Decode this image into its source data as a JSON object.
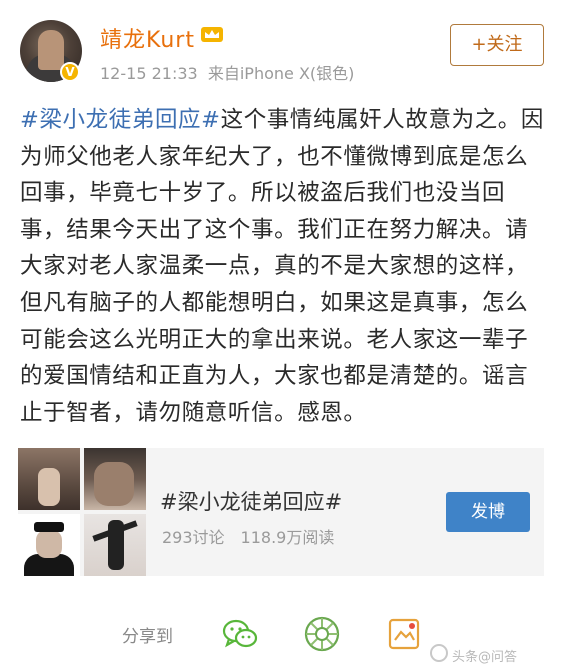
{
  "header": {
    "username": "靖龙Kurt",
    "verified_badge": "V",
    "timestamp": "12-15 21:33",
    "source": "来自iPhone X(银色)",
    "follow_label": "+关注",
    "crown_icon": "crown-icon"
  },
  "post": {
    "hashtag": "#梁小龙徒弟回应#",
    "text": "这个事情纯属奸人故意为之。因为师父他老人家年纪大了，也不懂微博到底是怎么回事，毕竟七十岁了。所以被盗后我们也没当回事，结果今天出了这个事。我们正在努力解决。请大家对老人家温柔一点，真的不是大家想的这样，但凡有脑子的人都能想明白，如果这是真事，怎么可能会这么光明正大的拿出来说。老人家这一辈子的爱国情结和正直为人，大家也都是清楚的。谣言止于智者，请勿随意听信。感恩。"
  },
  "topic_card": {
    "title": "#梁小龙徒弟回应#",
    "discussions": "293讨论",
    "reads": "118.9万阅读",
    "post_button": "发博"
  },
  "share": {
    "label": "分享到",
    "icons": [
      "wechat-icon",
      "moments-icon",
      "weibo-icon"
    ]
  },
  "watermark": "头条@问答",
  "colors": {
    "username": "#e8700c",
    "hashtag": "#3d6fb2",
    "post_button": "#3f83c8",
    "follow_border": "#b07a3c"
  }
}
